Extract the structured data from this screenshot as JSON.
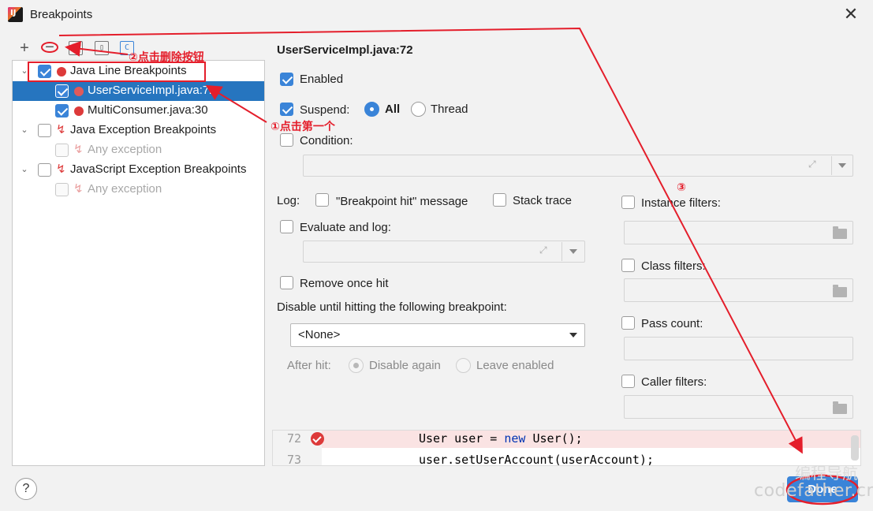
{
  "window": {
    "title": "Breakpoints",
    "close_label": "✕"
  },
  "toolbar": {
    "add": "+",
    "remove": "−",
    "group_package": "[]",
    "group_file": "▯",
    "group_class": "C"
  },
  "tree": {
    "rows": [
      {
        "label": "Java Line Breakpoints",
        "checked": true
      },
      {
        "label": "UserServiceImpl.java:72",
        "checked": true,
        "selected": true
      },
      {
        "label": "MultiConsumer.java:30",
        "checked": true
      },
      {
        "label": "Java Exception Breakpoints",
        "checked": false
      },
      {
        "label": "Any exception",
        "checked": false,
        "disabled": true
      },
      {
        "label": "JavaScript Exception Breakpoints",
        "checked": false
      },
      {
        "label": "Any exception",
        "checked": false,
        "disabled": true
      }
    ]
  },
  "detail": {
    "header": "UserServiceImpl.java:72",
    "enabled": "Enabled",
    "suspend": "Suspend:",
    "all": "All",
    "thread": "Thread",
    "condition": "Condition:",
    "log": "Log:",
    "breakpoint_hit": "\"Breakpoint hit\" message",
    "stack_trace": "Stack trace",
    "evaluate_log": "Evaluate and log:",
    "remove_once_hit": "Remove once hit",
    "disable_until": "Disable until hitting the following breakpoint:",
    "none_option": "<None>",
    "after_hit": "After hit:",
    "disable_again": "Disable again",
    "leave_enabled": "Leave enabled",
    "instance_filters": "Instance filters:",
    "class_filters": "Class filters:",
    "pass_count": "Pass count:",
    "caller_filters": "Caller filters:"
  },
  "code": {
    "lines": [
      {
        "number": "72",
        "prefix": "User user = ",
        "keyword": "new",
        "suffix": " User();"
      },
      {
        "number": "73",
        "text": "user.setUserAccount(userAccount);"
      }
    ]
  },
  "footer": {
    "help": "?",
    "done": "Done"
  },
  "annotations": {
    "step1": "①点击第一个",
    "step2": "②点击删除按钮",
    "step3": "③"
  },
  "watermark": {
    "line1": "编程导航",
    "line2": "codefather.cn"
  },
  "colors": {
    "accent": "#3a84d8",
    "selection": "#2675bf",
    "breakpoint": "#dd3a3a",
    "annotation": "#e41e2b"
  }
}
